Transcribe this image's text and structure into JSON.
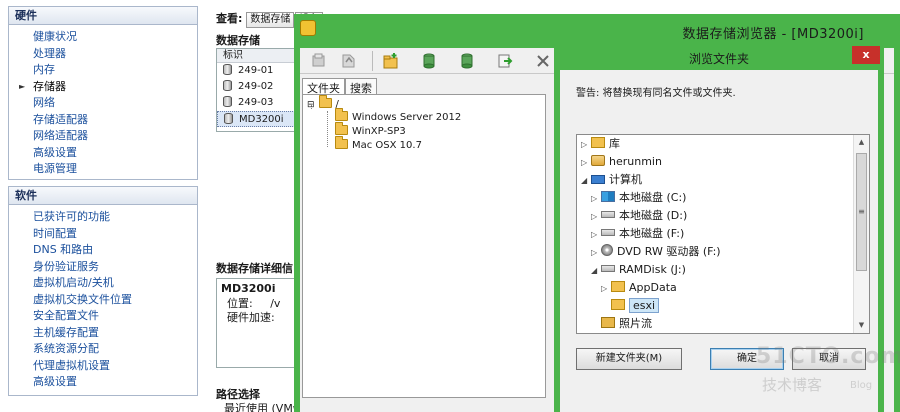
{
  "leftnav": {
    "hardware": {
      "title": "硬件",
      "items": [
        "健康状况",
        "处理器",
        "内存",
        "存储器",
        "网络",
        "存储适配器",
        "网络适配器",
        "高级设置",
        "电源管理"
      ]
    },
    "software": {
      "title": "软件",
      "items": [
        "已获许可的功能",
        "时间配置",
        "DNS 和路由",
        "身份验证服务",
        "虚拟机启动/关机",
        "虚拟机交换文件位置",
        "安全配置文件",
        "主机缓存配置",
        "系统资源分配",
        "代理虚拟机设置",
        "高级设置"
      ]
    }
  },
  "mid": {
    "view_label": "查看:",
    "view_btn1": "数据存储",
    "view_btn2": "设备",
    "datastores_title": "数据存储",
    "col_label": "标识",
    "rows": [
      "249-01",
      "249-02",
      "249-03",
      "MD3200i"
    ],
    "details_title": "数据存储详细信",
    "detail_name": "MD3200i",
    "detail_location": "位置:",
    "detail_location_val": "/v",
    "detail_hw": "硬件加速:",
    "path_title": "路径选择",
    "path_line": "最近使用 (VMw"
  },
  "browser": {
    "title": "数据存储浏览器 - [MD3200i]",
    "tab_folders": "文件夹",
    "tab_search": "搜索",
    "root": "/",
    "folders": [
      "Windows Server 2012",
      "WinXP-SP3",
      "Mac OSX 10.7"
    ]
  },
  "dialog": {
    "title": "浏览文件夹",
    "close": "x",
    "warning": "警告: 将替换现有同名文件或文件夹.",
    "nodes": [
      "库",
      "herunmin",
      "计算机",
      "本地磁盘 (C:)",
      "本地磁盘 (D:)",
      "本地磁盘 (F:)",
      "DVD RW 驱动器 (F:)",
      "RAMDisk (J:)",
      "AppData",
      "esxi",
      "照片流"
    ],
    "new_folder": "新建文件夹(M)",
    "ok": "确定",
    "cancel": "取消"
  },
  "watermark": {
    "line1": "51CTO.com",
    "line2": "技术博客",
    "line3": "Blog"
  }
}
